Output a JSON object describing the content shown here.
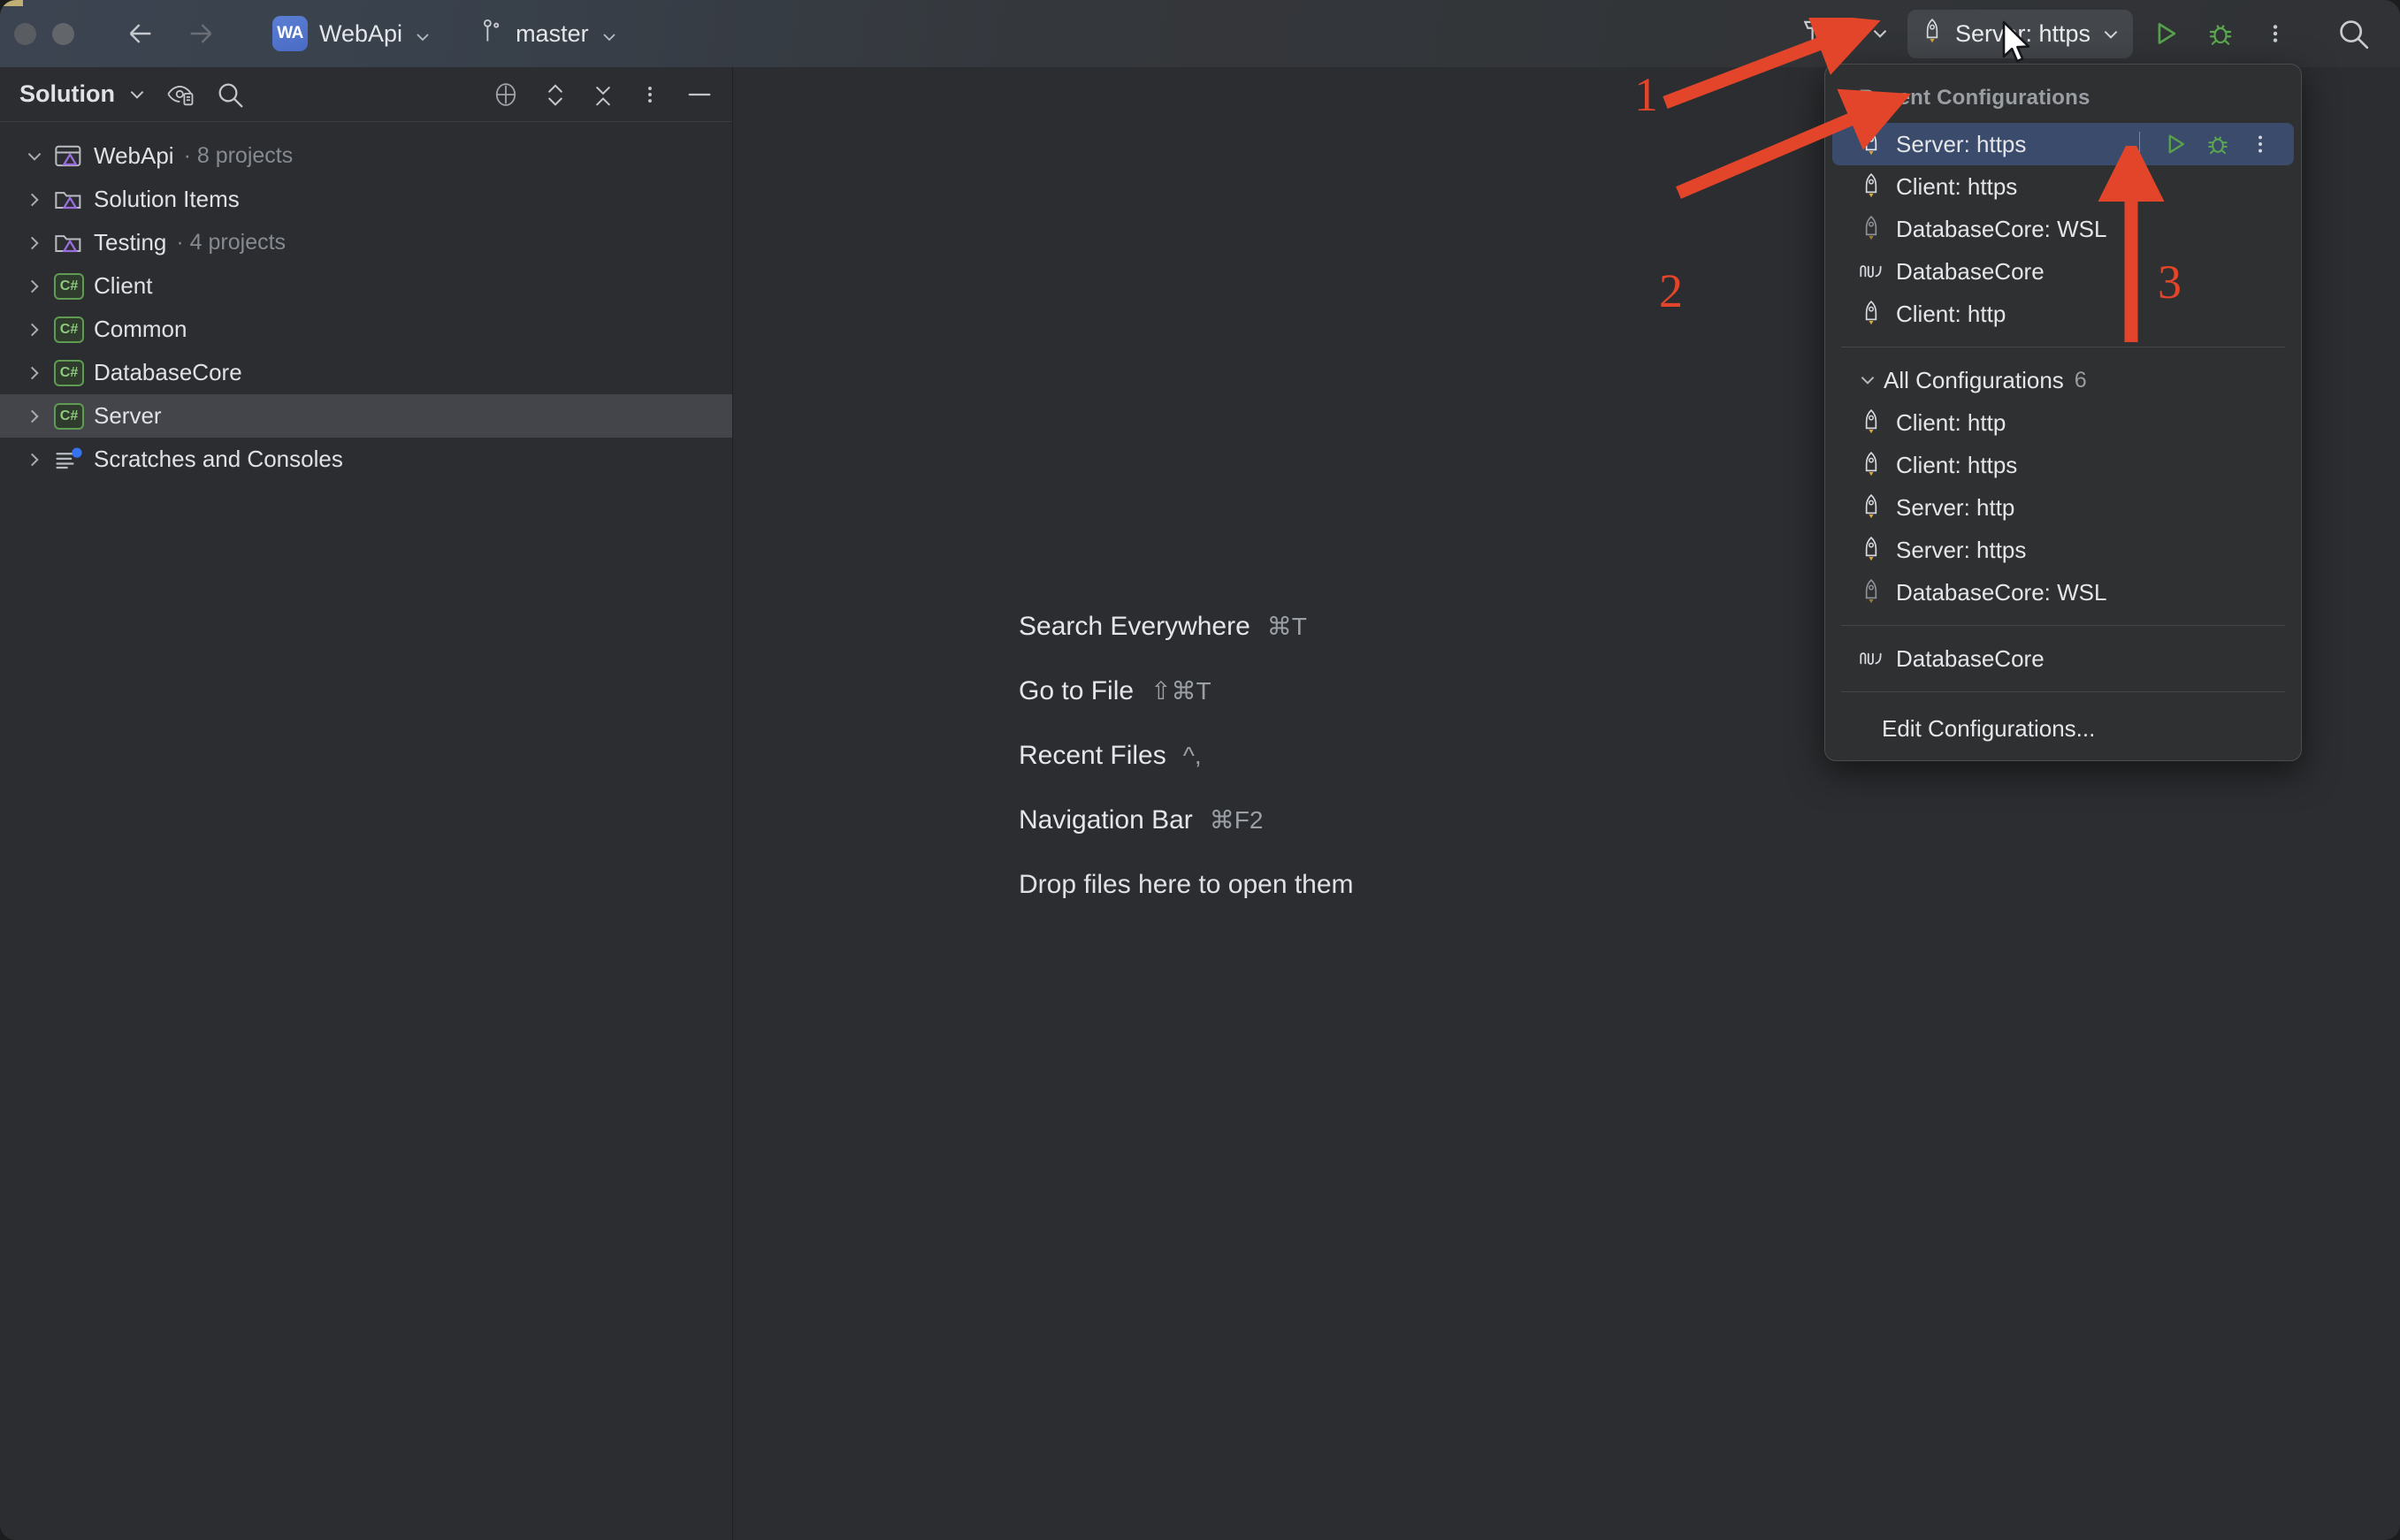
{
  "titlebar": {
    "project_badge": "WA",
    "project_name": "WebApi",
    "branch_name": "master",
    "back_icon": "back-arrow-icon",
    "forward_icon": "forward-arrow-icon",
    "build_icon": "hammer-icon",
    "build_chevron_icon": "chevron-down-icon",
    "run_config_label": "Server: https",
    "run_config_icon": "rocket-icon",
    "run_config_chevron_icon": "chevron-down-icon",
    "run_icon": "run-triangle-icon",
    "debug_icon": "debug-bug-icon",
    "more_icon": "more-vertical-icon",
    "search_icon": "search-icon"
  },
  "sidebar": {
    "title": "Solution",
    "title_chevron_icon": "chevron-down-icon",
    "scope_icon": "eye-scope-icon",
    "search_icon": "search-icon",
    "locate_icon": "target-crosshair-icon",
    "expand_icon": "expand-all-icon",
    "collapse_icon": "collapse-all-icon",
    "options_icon": "more-vertical-icon",
    "hide_icon": "minimize-icon",
    "tree": [
      {
        "label": "WebApi",
        "sub": "· 8 projects",
        "icon": "solution-icon",
        "twisty": "expanded",
        "depth": 0,
        "selected": false
      },
      {
        "label": "Solution Items",
        "sub": "",
        "icon": "folder-solution-icon",
        "twisty": "collapsed",
        "depth": 1,
        "selected": false
      },
      {
        "label": "Testing",
        "sub": "· 4 projects",
        "icon": "folder-solution-icon",
        "twisty": "collapsed",
        "depth": 1,
        "selected": false
      },
      {
        "label": "Client",
        "sub": "",
        "icon": "csharp-project-icon",
        "twisty": "collapsed",
        "depth": 1,
        "selected": false
      },
      {
        "label": "Common",
        "sub": "",
        "icon": "csharp-project-icon",
        "twisty": "collapsed",
        "depth": 1,
        "selected": false
      },
      {
        "label": "DatabaseCore",
        "sub": "",
        "icon": "csharp-project-icon",
        "twisty": "collapsed",
        "depth": 1,
        "selected": false
      },
      {
        "label": "Server",
        "sub": "",
        "icon": "csharp-project-icon",
        "twisty": "collapsed",
        "depth": 1,
        "selected": true
      },
      {
        "label": "Scratches and Consoles",
        "sub": "",
        "icon": "scratches-icon",
        "twisty": "collapsed",
        "depth": 0,
        "selected": false
      }
    ]
  },
  "editor": {
    "hints": [
      {
        "label": "Search Everywhere",
        "key": "⌘T"
      },
      {
        "label": "Go to File",
        "key": "⇧⌘T"
      },
      {
        "label": "Recent Files",
        "key": "^,"
      },
      {
        "label": "Navigation Bar",
        "key": "⌘F2"
      }
    ],
    "drop_text": "Drop files here to open them"
  },
  "popup": {
    "header": "Recent Configurations",
    "recent": [
      {
        "label": "Server: https",
        "icon": "rocket-icon",
        "selected": true
      },
      {
        "label": "Client: https",
        "icon": "rocket-icon",
        "selected": false
      },
      {
        "label": "DatabaseCore: WSL",
        "icon": "rocket-dim-icon",
        "selected": false
      },
      {
        "label": "DatabaseCore",
        "icon": "database-wave-icon",
        "selected": false
      },
      {
        "label": "Client: http",
        "icon": "rocket-icon",
        "selected": false
      }
    ],
    "row_actions": {
      "run_icon": "run-triangle-icon",
      "debug_icon": "debug-bug-icon",
      "more_icon": "more-vertical-icon"
    },
    "group": {
      "label": "All Configurations",
      "count": "6",
      "chevron_icon": "chevron-down-icon",
      "items": [
        {
          "label": "Client: http",
          "icon": "rocket-icon"
        },
        {
          "label": "Client: https",
          "icon": "rocket-icon"
        },
        {
          "label": "Server: http",
          "icon": "rocket-icon"
        },
        {
          "label": "Server: https",
          "icon": "rocket-icon"
        },
        {
          "label": "DatabaseCore: WSL",
          "icon": "rocket-dim-icon"
        }
      ]
    },
    "extra": {
      "label": "DatabaseCore",
      "icon": "database-wave-icon"
    },
    "edit_label": "Edit Configurations..."
  },
  "annotations": {
    "color": "#e2452a",
    "items": [
      {
        "number": "1",
        "points_to": "run-config-widget"
      },
      {
        "number": "2",
        "points_to": "popup-selected-row"
      },
      {
        "number": "3",
        "points_to": "popup-row-run-button"
      }
    ]
  },
  "cursor": {
    "icon": "mouse-pointer-icon"
  }
}
